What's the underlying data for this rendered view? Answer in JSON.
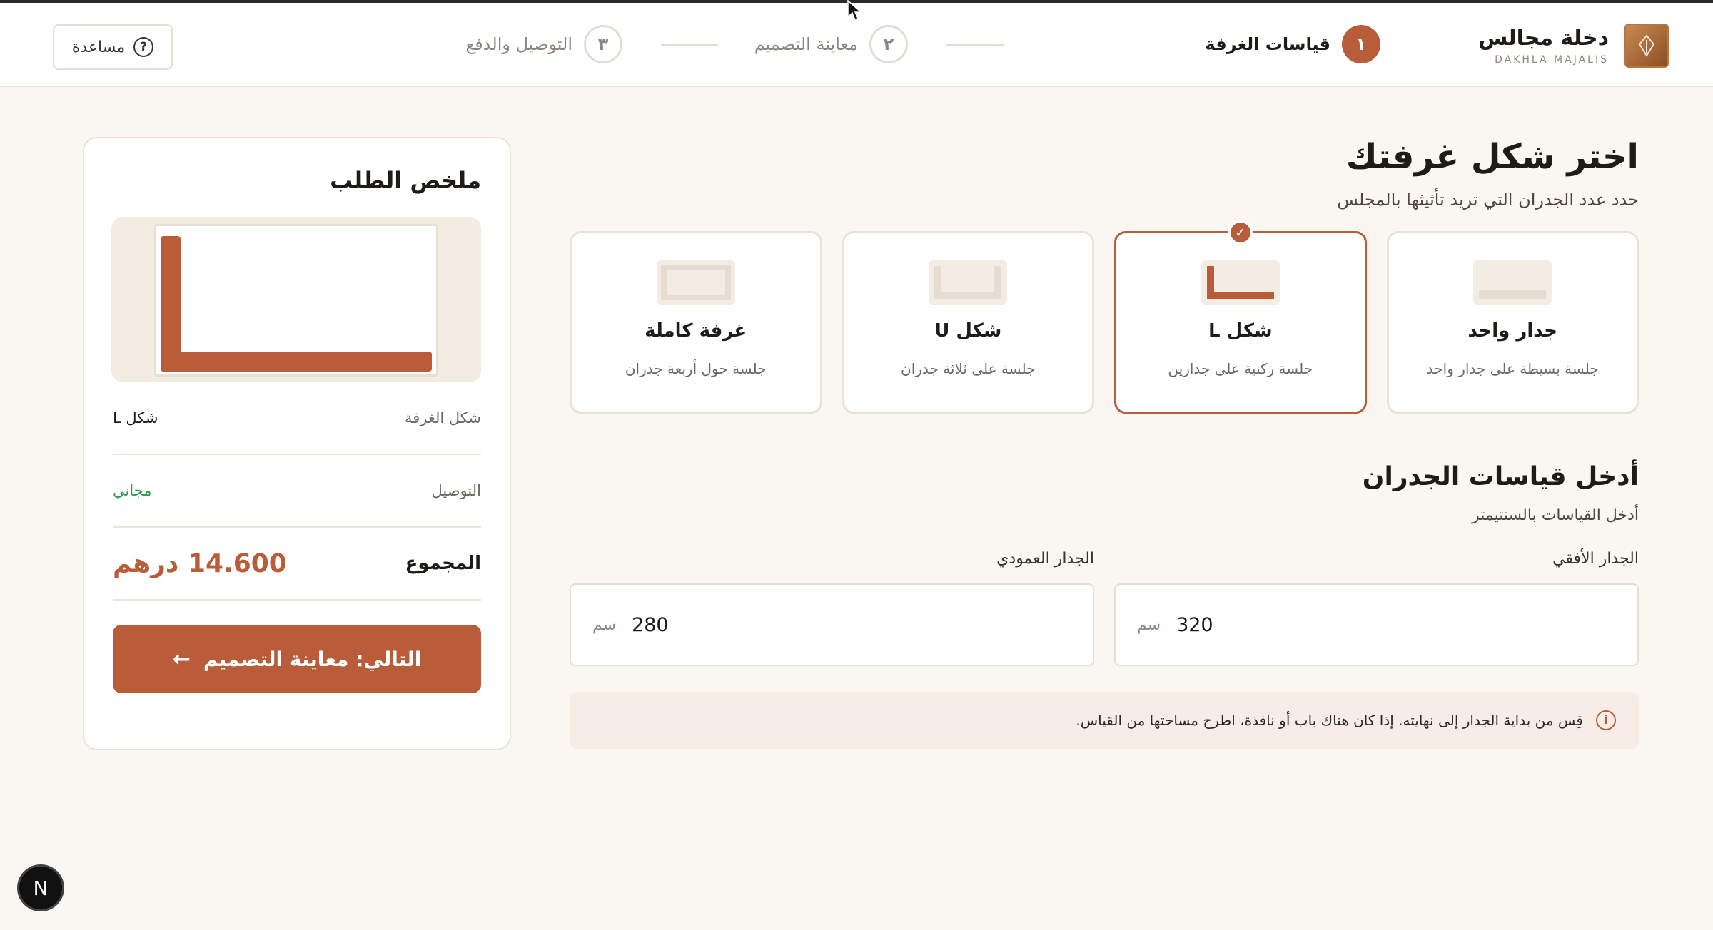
{
  "brand": {
    "name": "دخلة مجالس",
    "sub": "DAKHLA MAJALIS"
  },
  "steps": [
    {
      "number": "١",
      "label": "قياسات الغرفة",
      "state": "active"
    },
    {
      "number": "٢",
      "label": "معاينة التصميم",
      "state": "inactive"
    },
    {
      "number": "٣",
      "label": "التوصيل والدفع",
      "state": "inactive"
    }
  ],
  "help": {
    "label": "مساعدة",
    "icon": "question-circle-icon"
  },
  "main": {
    "title": "اختر شكل غرفتك",
    "subtitle": "حدد عدد الجدران التي تريد تأثيثها بالمجلس",
    "shapes": [
      {
        "title": "جدار واحد",
        "desc": "جلسة بسيطة على جدار واحد",
        "selected": false
      },
      {
        "title": "شكل L",
        "desc": "جلسة ركنية على جدارين",
        "selected": true
      },
      {
        "title": "شكل U",
        "desc": "جلسة على ثلاثة جدران",
        "selected": false
      },
      {
        "title": "غرفة كاملة",
        "desc": "جلسة حول أربعة جدران",
        "selected": false
      }
    ],
    "check_icon": "✓",
    "measure_title": "أدخل قياسات الجدران",
    "measure_subtitle": "أدخل القياسات بالسنتيمتر",
    "fields": [
      {
        "label": "الجدار الأفقي",
        "value": "320",
        "unit": "سم"
      },
      {
        "label": "الجدار العمودي",
        "value": "280",
        "unit": "سم"
      }
    ],
    "info": {
      "icon": "i",
      "text": "قِس من بداية الجدار إلى نهايته. إذا كان هناك باب أو نافذة، اطرح مساحتها من القياس."
    }
  },
  "summary": {
    "title": "ملخص الطلب",
    "rows": [
      {
        "label": "شكل الغرفة",
        "value": "شكل L"
      },
      {
        "label": "التوصيل",
        "value": "مجاني"
      }
    ],
    "total_label": "المجموع",
    "total_value": "14.600 درهم",
    "next_label": "التالي: معاينة التصميم",
    "next_arrow": "←"
  },
  "dev_badge": "N",
  "colors": {
    "accent": "#b85c3a",
    "free": "#2d9a4e",
    "bg": "#faf7f2"
  }
}
